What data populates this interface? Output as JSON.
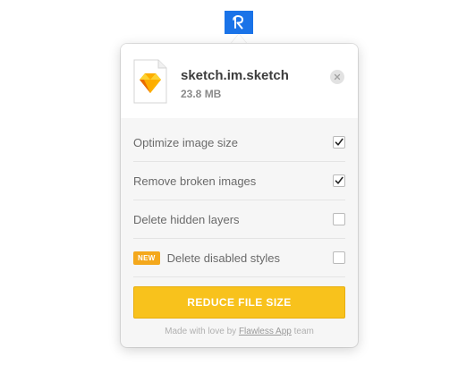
{
  "menubar": {
    "icon": "flawless-r-logo-icon",
    "accent": "#1a73e8"
  },
  "file": {
    "icon": "sketch-file-icon",
    "name": "sketch.im.sketch",
    "size": "23.8 MB"
  },
  "close": {
    "icon": "close-icon",
    "glyph": "×"
  },
  "options": [
    {
      "label": "Optimize image size",
      "checked": true,
      "badge": ""
    },
    {
      "label": "Remove broken images",
      "checked": true,
      "badge": ""
    },
    {
      "label": "Delete hidden layers",
      "checked": false,
      "badge": ""
    },
    {
      "label": "Delete disabled styles",
      "checked": false,
      "badge": "NEW"
    }
  ],
  "button": {
    "label": "REDUCE FILE SIZE",
    "color": "#f8c21c"
  },
  "footer": {
    "prefix": "Made with love by ",
    "link": "Flawless App",
    "suffix": " team"
  }
}
